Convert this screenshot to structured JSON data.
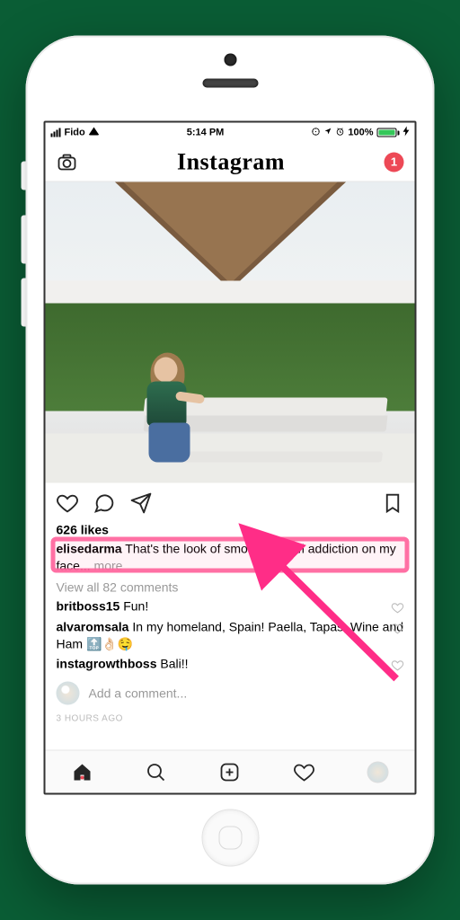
{
  "status": {
    "carrier": "Fido",
    "time": "5:14 PM",
    "battery_pct": "100%"
  },
  "header": {
    "brand": "Instagram",
    "dm_badge": "1"
  },
  "post": {
    "likes": "626 likes",
    "caption_user": "elisedarma",
    "caption_text": " That's the look of smoothie bowl addiction on my face... ",
    "more": "more",
    "view_all": "View all 82 comments",
    "comments": [
      {
        "user": "britboss15",
        "text": " Fun!"
      },
      {
        "user": "alvaromsala",
        "text": " In my homeland, Spain! Paella, Tapas, Wine and Ham 🔝👌🏻🤤"
      },
      {
        "user": "instagrowthboss",
        "text": " Bali!!"
      }
    ],
    "add_comment_placeholder": "Add a comment...",
    "timestamp": "3 HOURS AGO"
  }
}
